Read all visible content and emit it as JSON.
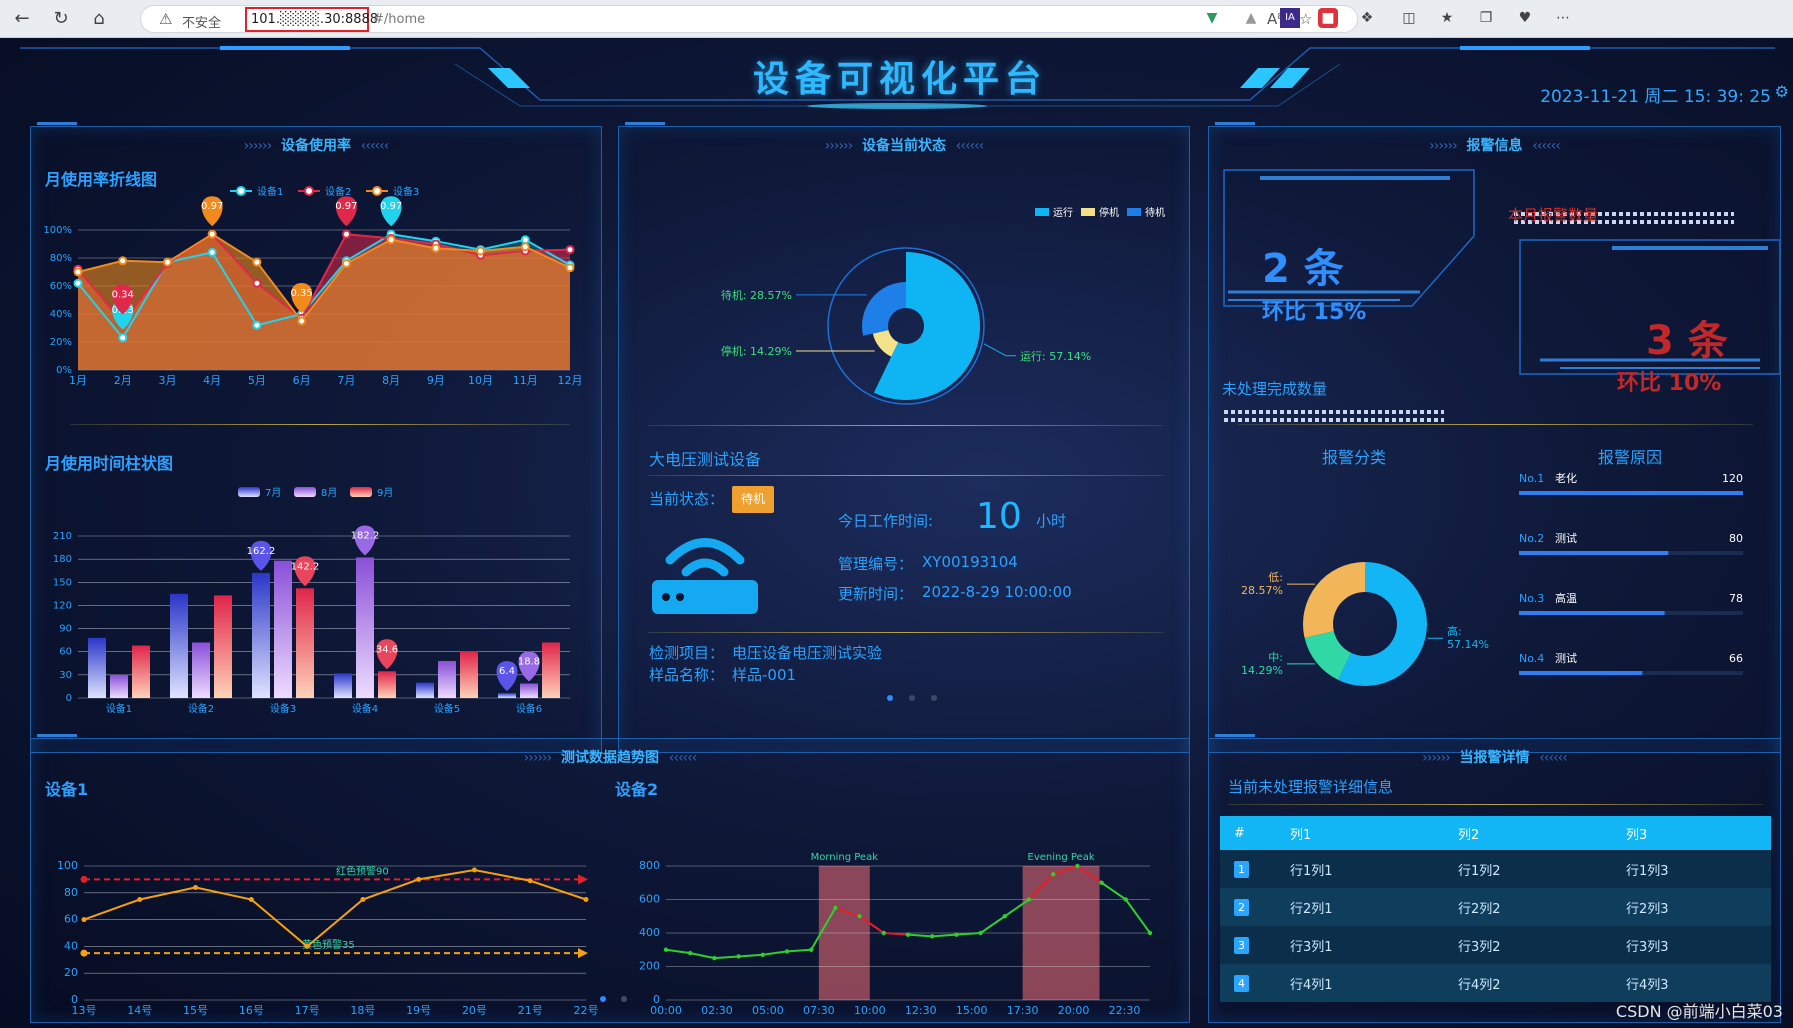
{
  "browser": {
    "security_label": "不安全",
    "url_host": "101.░░░░.30:8888",
    "url_path": "#/home"
  },
  "header": {
    "title": "设备可视化平台",
    "datetime": "2023-11-21 周二 15: 39: 25"
  },
  "usage_panel": {
    "title": "设备使用率",
    "line_title": "月使用率折线图",
    "bar_title": "月使用时间柱状图"
  },
  "status_panel": {
    "title": "设备当前状态",
    "device_name": "大电压测试设备",
    "current_status_label": "当前状态：",
    "status_badge": "待机",
    "work_time_label": "今日工作时间:",
    "work_time_value": "10",
    "work_time_unit": "小时",
    "manage_code_label": "管理编号：",
    "manage_code": "XY00193104",
    "update_time_label": "更新时间：",
    "update_time": "2022-8-29 10:00:00",
    "test_item_label": "检测项目：",
    "test_item": "电压设备电压测试实验",
    "sample_label": "样品名称：",
    "sample": "样品-001"
  },
  "alarm_panel": {
    "title": "报警信息",
    "monthly_label": "本月报警数量",
    "unhandled_label": "未处理完成数量",
    "box1_count": "2 条",
    "box1_ratio": "环比 15%",
    "box2_count": "3 条",
    "box2_ratio": "环比 10%",
    "category_title": "报警分类",
    "reason_title": "报警原因",
    "reasons": [
      {
        "rank": "No.1",
        "name": "老化",
        "value": 120
      },
      {
        "rank": "No.2",
        "name": "测试",
        "value": 80
      },
      {
        "rank": "No.3",
        "name": "高温",
        "value": 78
      },
      {
        "rank": "No.4",
        "name": "测试",
        "value": 66
      }
    ]
  },
  "trend_panel": {
    "title": "测试数据趋势图",
    "device1_title": "设备1",
    "device2_title": "设备2"
  },
  "detail_panel": {
    "title": "当报警详情",
    "subtitle": "当前未处理报警详细信息",
    "columns": [
      "#",
      "列1",
      "列2",
      "列3"
    ],
    "rows": [
      [
        "1",
        "行1列1",
        "行1列2",
        "行1列3"
      ],
      [
        "2",
        "行2列1",
        "行2列2",
        "行2列3"
      ],
      [
        "3",
        "行3列1",
        "行3列2",
        "行3列3"
      ],
      [
        "4",
        "行4列1",
        "行4列2",
        "行4列3"
      ]
    ]
  },
  "watermark": "CSDN @前端小白菜03",
  "colors": {
    "accent": "#2aa9ff",
    "series_cyan": "#22d3ee",
    "series_red": "#e0294a",
    "series_orange": "#f08a1c",
    "alarm_blue": "#2f8fff",
    "alarm_red": "#c0282a",
    "table_header": "#12b6f5"
  },
  "chart_data": [
    {
      "type": "line",
      "title": "月使用率折线图",
      "x": [
        "1月",
        "2月",
        "3月",
        "4月",
        "5月",
        "6月",
        "7月",
        "8月",
        "9月",
        "10月",
        "11月",
        "12月"
      ],
      "ylim": [
        0,
        100
      ],
      "yticks": [
        "0%",
        "20%",
        "40%",
        "60%",
        "80%",
        "100%"
      ],
      "series": [
        {
          "name": "设备1",
          "values": [
            62,
            23,
            77,
            84,
            32,
            40,
            78,
            97,
            92,
            86,
            93,
            75
          ]
        },
        {
          "name": "设备2",
          "values": [
            72,
            34,
            76,
            97,
            62,
            37,
            97,
            94,
            90,
            82,
            85,
            86
          ]
        },
        {
          "name": "设备3",
          "values": [
            70,
            78,
            77,
            97,
            77,
            35,
            76,
            93,
            87,
            85,
            88,
            73
          ]
        }
      ],
      "annotations": [
        {
          "series": "设备1",
          "x": "2月",
          "label": "0.23"
        },
        {
          "series": "设备1",
          "x": "8月",
          "label": "0.97"
        },
        {
          "series": "设备2",
          "x": "2月",
          "label": "0.34"
        },
        {
          "series": "设备2",
          "x": "7月",
          "label": "0.97"
        },
        {
          "series": "设备3",
          "x": "4月",
          "label": "0.97"
        },
        {
          "series": "设备3",
          "x": "6月",
          "label": "0.35"
        }
      ]
    },
    {
      "type": "bar",
      "title": "月使用时间柱状图",
      "categories": [
        "设备1",
        "设备2",
        "设备3",
        "设备4",
        "设备5",
        "设备6"
      ],
      "ylim": [
        0,
        210
      ],
      "yticks": [
        "0",
        "30",
        "60",
        "90",
        "120",
        "150",
        "180",
        "210"
      ],
      "series": [
        {
          "name": "7月",
          "values": [
            78,
            135,
            162.2,
            32,
            20,
            6.4
          ]
        },
        {
          "name": "8月",
          "values": [
            30,
            72,
            178,
            182.2,
            48,
            18.8
          ]
        },
        {
          "name": "9月",
          "values": [
            68,
            133,
            142.2,
            34.6,
            60,
            72
          ]
        }
      ],
      "markers": [
        {
          "category": "设备3",
          "series": "7月",
          "label": "162.2"
        },
        {
          "category": "设备3",
          "series": "9月",
          "label": "142.2"
        },
        {
          "category": "设备4",
          "series": "8月",
          "label": "182.2"
        },
        {
          "category": "设备4",
          "series": "9月",
          "label": "34.6"
        },
        {
          "category": "设备6",
          "series": "7月",
          "label": "6.4"
        },
        {
          "category": "设备6",
          "series": "8月",
          "label": "18.8"
        }
      ]
    },
    {
      "type": "pie",
      "title": "设备当前状态",
      "legend": [
        "运行",
        "停机",
        "待机"
      ],
      "slices": [
        {
          "name": "运行",
          "value": 57.14,
          "label": "运行: 57.14%"
        },
        {
          "name": "停机",
          "value": 14.29,
          "label": "停机: 14.29%"
        },
        {
          "name": "待机",
          "value": 28.57,
          "label": "待机: 28.57%"
        }
      ]
    },
    {
      "type": "pie",
      "title": "报警分类",
      "slices": [
        {
          "name": "高",
          "value": 57.14,
          "label": "57.14%"
        },
        {
          "name": "中",
          "value": 14.29,
          "label": "14.29%"
        },
        {
          "name": "低",
          "value": 28.57,
          "label": "28.57%"
        }
      ]
    },
    {
      "type": "line",
      "title": "设备1",
      "x": [
        "13号",
        "14号",
        "15号",
        "16号",
        "17号",
        "18号",
        "19号",
        "20号",
        "21号",
        "22号"
      ],
      "ylim": [
        0,
        100
      ],
      "yticks": [
        "0",
        "20",
        "40",
        "60",
        "80",
        "100"
      ],
      "series": [
        {
          "values": [
            60,
            75,
            84,
            75,
            40,
            75,
            90,
            97,
            89,
            75
          ]
        }
      ],
      "reference_lines": [
        {
          "label": "红色预警90",
          "value": 90
        },
        {
          "label": "黄色预警35",
          "value": 35
        }
      ]
    },
    {
      "type": "line",
      "title": "设备2",
      "x": [
        "00:00",
        "02:30",
        "05:00",
        "07:30",
        "10:00",
        "12:30",
        "15:00",
        "17:30",
        "20:00",
        "22:30"
      ],
      "ylim": [
        0,
        800
      ],
      "yticks": [
        "0",
        "200",
        "400",
        "600",
        "800"
      ],
      "series": [
        {
          "values": [
            300,
            280,
            250,
            260,
            270,
            290,
            300,
            550,
            500,
            400,
            390,
            380,
            390,
            400,
            500,
            600,
            750,
            800,
            700,
            600,
            400
          ]
        }
      ],
      "mark_areas": [
        {
          "label": "Morning Peak",
          "from": "07:30",
          "to": "10:00"
        },
        {
          "label": "Evening Peak",
          "from": "17:30",
          "to": "21:15"
        }
      ]
    }
  ]
}
